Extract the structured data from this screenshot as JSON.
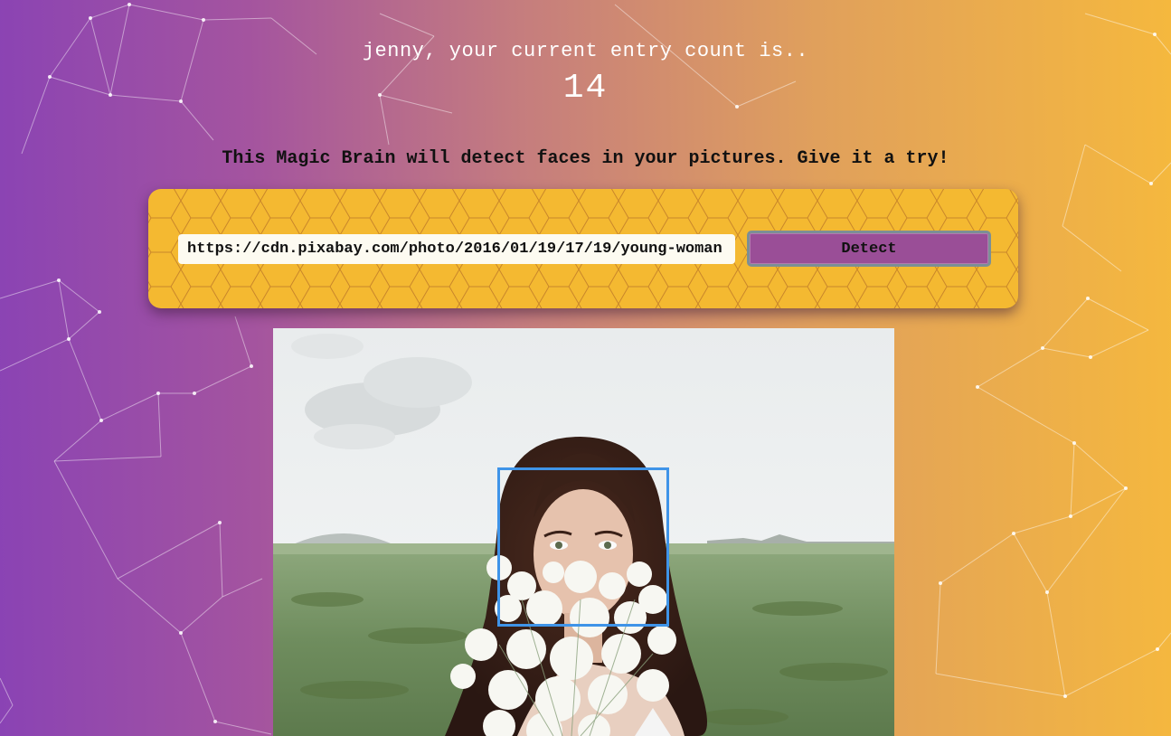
{
  "rank": {
    "message": "jenny, your current entry count is..",
    "count": "14"
  },
  "intro": {
    "text": "This Magic Brain will detect faces in your pictures. Give it a try!"
  },
  "form": {
    "url_value": "https://cdn.pixabay.com/photo/2016/01/19/17/19/young-woman",
    "detect_label": "Detect"
  },
  "colors": {
    "gradient_start": "#8a43b4",
    "gradient_end": "#f5b83e",
    "panel": "#f4b931",
    "button": "#9a4e97",
    "face_box": "#3f94e8"
  },
  "image": {
    "subject": "woman-holding-white-flowers-in-field"
  }
}
